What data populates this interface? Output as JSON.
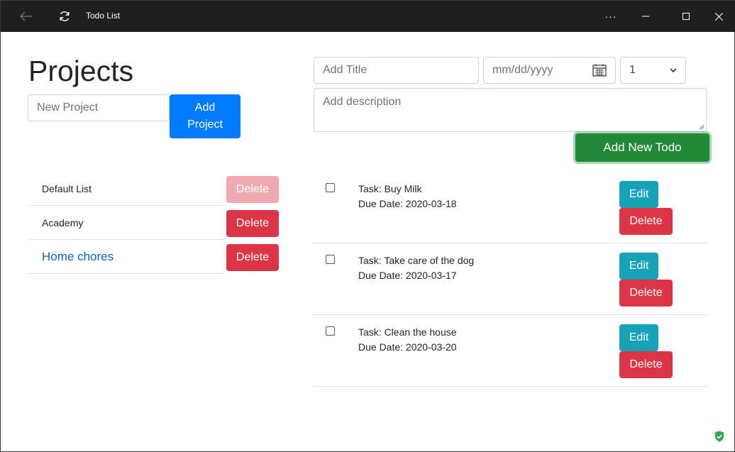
{
  "window": {
    "title": "Todo List",
    "more_label": "···"
  },
  "projects": {
    "heading": "Projects",
    "new_project_placeholder": "New Project",
    "add_button": "Add Project",
    "items": [
      {
        "name": "Default List",
        "delete_label": "Delete",
        "delete_disabled": true
      },
      {
        "name": "Academy",
        "delete_label": "Delete",
        "delete_disabled": false
      },
      {
        "name": "Home chores",
        "delete_label": "Delete",
        "delete_disabled": false,
        "active": true
      }
    ]
  },
  "todo_form": {
    "title_placeholder": "Add Title",
    "date_placeholder": "mm/dd/yyyy",
    "priority_value": "1",
    "description_placeholder": "Add description",
    "add_button": "Add New Todo"
  },
  "todos": [
    {
      "task": "Task: Buy Milk",
      "due": "Due Date: 2020-03-18",
      "edit_label": "Edit",
      "delete_label": "Delete",
      "done": false
    },
    {
      "task": "Task: Take care of the dog",
      "due": "Due Date: 2020-03-17",
      "edit_label": "Edit",
      "delete_label": "Delete",
      "done": false
    },
    {
      "task": "Task: Clean the house",
      "due": "Due Date: 2020-03-20",
      "edit_label": "Edit",
      "delete_label": "Delete",
      "done": false
    }
  ],
  "colors": {
    "primary": "#007bff",
    "danger": "#dc3545",
    "danger_disabled": "#f0a9b1",
    "info": "#17a2b8",
    "success": "#218838",
    "link": "#0b63c7",
    "titlebar": "#1f1f1f"
  }
}
